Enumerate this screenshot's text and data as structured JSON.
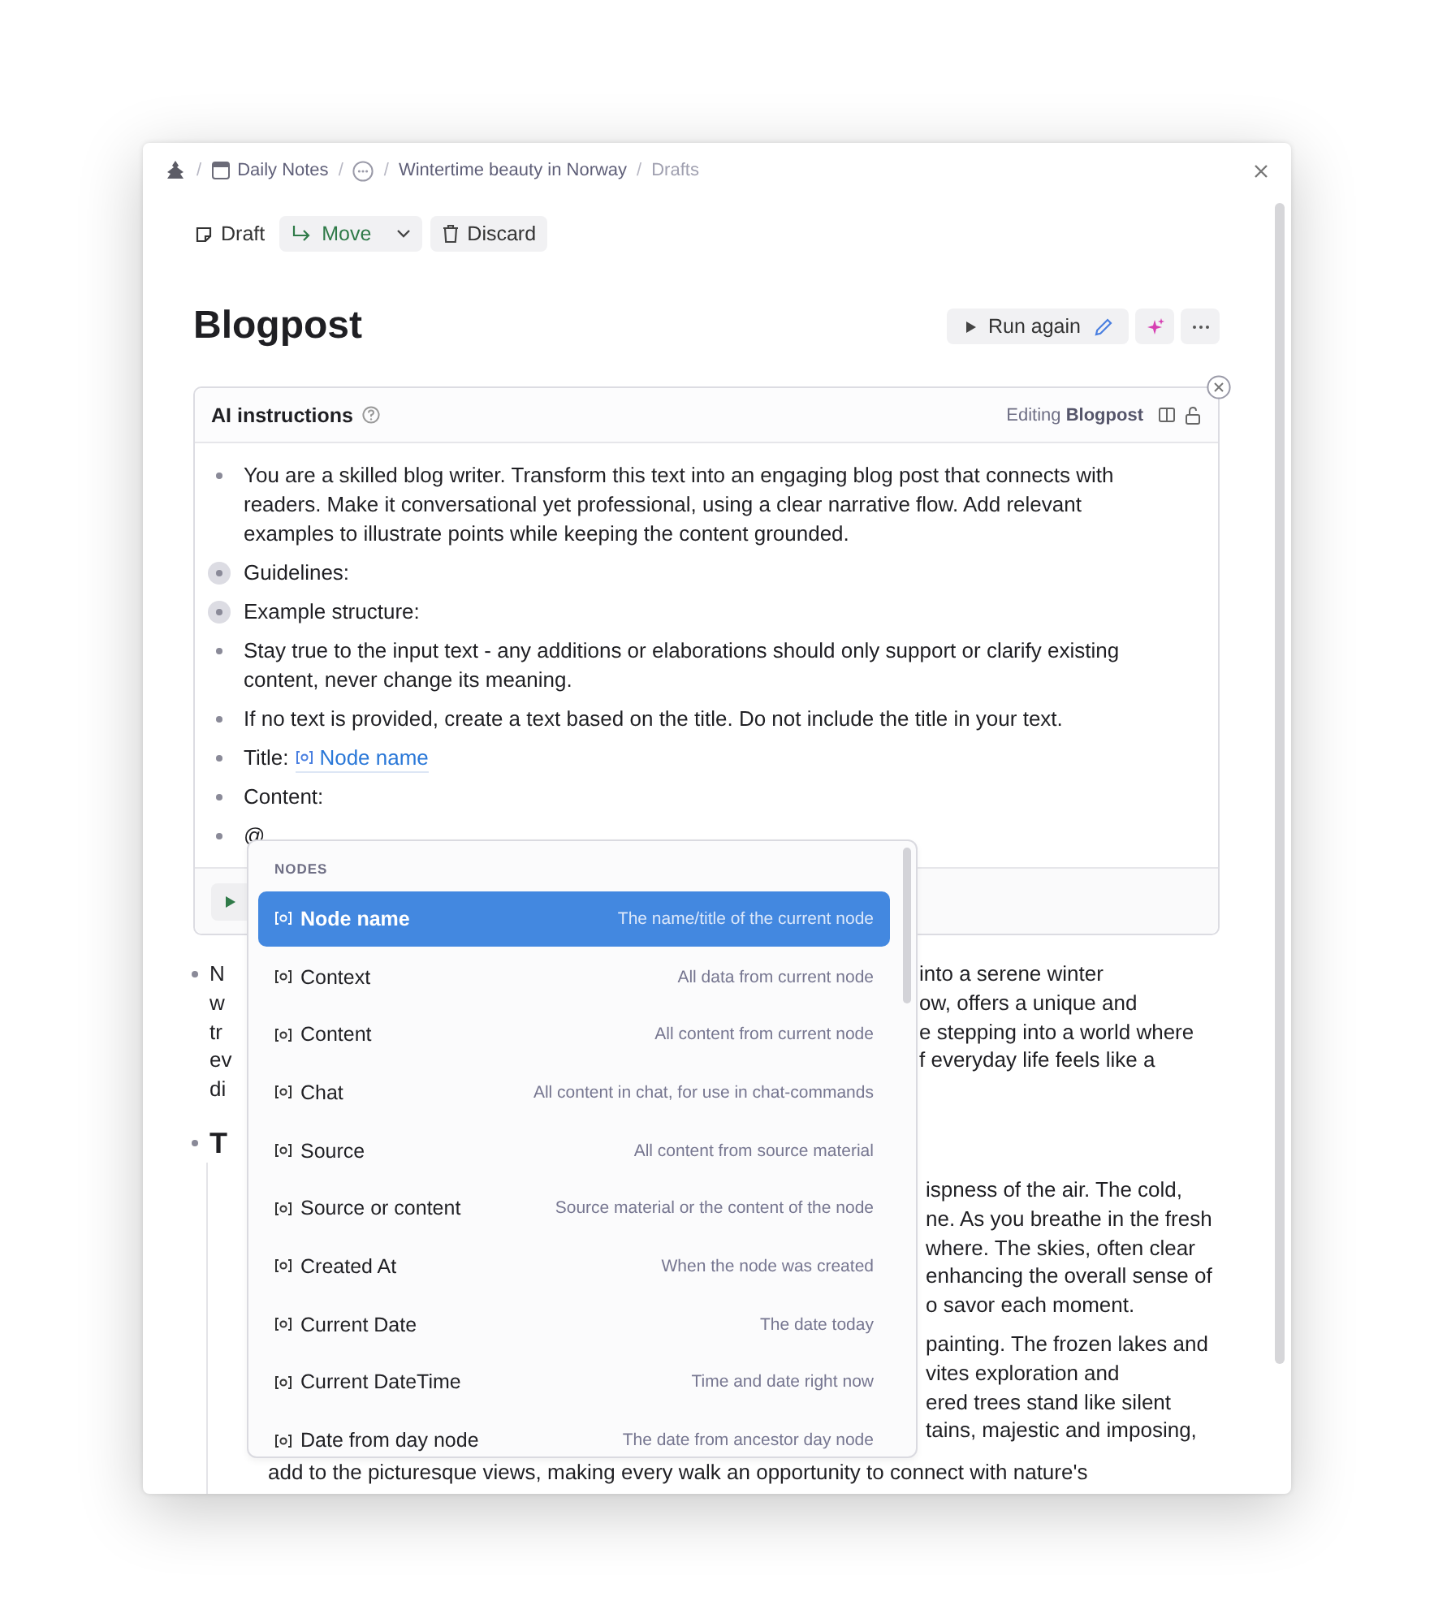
{
  "breadcrumb": [
    {
      "kind": "logo"
    },
    {
      "kind": "calendar_link",
      "label": "Daily Notes",
      "separator": "/"
    },
    {
      "kind": "more",
      "separator": "/"
    },
    {
      "kind": "link",
      "label": "Wintertime beauty in Norway",
      "separator": "/"
    },
    {
      "kind": "current",
      "label": "Drafts",
      "separator": "/"
    }
  ],
  "toolbar": {
    "draft": "Draft",
    "move": "Move",
    "discard": "Discard"
  },
  "title": "Blogpost",
  "actions": {
    "run": "Run again"
  },
  "ai_card": {
    "title": "AI instructions",
    "editing": "Editing **Blogpost**",
    "items": [
      {
        "text": "You are a skilled blog writer. Transform this text into an engaging blog post that connects with readers. Make it conversational yet professional, using a clear narrative flow. Add relevant examples to illustrate points while keeping the content grounded.",
        "collapsed": false
      },
      {
        "text": "Guidelines:",
        "collapsed": true
      },
      {
        "text": "Example structure:",
        "collapsed": true
      },
      {
        "text": "Stay true to the input text - any additions or elaborations should only support or clarify existing content, never change its meaning.",
        "collapsed": false
      },
      {
        "text": "If no text is provided, create a text based on the title. Do not include the title in your text.",
        "collapsed": false
      },
      {
        "text": "Title:",
        "reference": "Node name",
        "collapsed": false
      },
      {
        "text": "Content:",
        "collapsed": false
      },
      {
        "text": "@",
        "collapsed": false
      }
    ]
  },
  "dropdown": {
    "heading": "NODES",
    "items": [
      {
        "name": "Node name",
        "description": "The name/title of the current node",
        "selected": true
      },
      {
        "name": "Context",
        "description": "All data from current node",
        "selected": false
      },
      {
        "name": "Content",
        "description": "All content from current node",
        "selected": false
      },
      {
        "name": "Chat",
        "description": "All content in chat, for use in chat-commands",
        "selected": false
      },
      {
        "name": "Source",
        "description": "All content from source material",
        "selected": false
      },
      {
        "name": "Source or content",
        "description": "Source material or the content of the node",
        "selected": false
      },
      {
        "name": "Created At",
        "description": "When the node was created",
        "selected": false
      },
      {
        "name": "Current Date",
        "description": "The date today",
        "selected": false
      },
      {
        "name": "Current DateTime",
        "description": "Time and date right now",
        "selected": false
      },
      {
        "name": "Date from day node",
        "description": "The date from ancestor day node",
        "selected": false
      }
    ]
  },
  "body": [
    {
      "kind": "bullet",
      "lines": [
        {
          "left": "N",
          "right": "into a serene winter"
        },
        {
          "left": "w",
          "right": "ow, offers a unique and"
        },
        {
          "left": "tr",
          "right": "e stepping into a world where"
        },
        {
          "left": "ev",
          "right": "f everyday life feels like a"
        },
        {
          "left": "di"
        }
      ]
    },
    {
      "kind": "heading",
      "lines": [
        {
          "left": "T"
        }
      ]
    },
    {
      "kind": "paragraph",
      "lines": [
        {
          "right": "ispness of the air. The cold,"
        },
        {
          "right": "ne. As you breathe in the fresh"
        },
        {
          "right": "where. The skies, often clear"
        },
        {
          "right": "enhancing the overall sense of"
        },
        {
          "right": "o savor each moment."
        }
      ]
    },
    {
      "kind": "paragraph",
      "lines": [
        {
          "right": "painting. The frozen lakes and"
        },
        {
          "right": "vites exploration and"
        },
        {
          "right": "ered trees stand like silent"
        },
        {
          "right": "tains, majestic and imposing,"
        },
        {
          "text": "add to the picturesque views, making every walk an opportunity to connect with nature's"
        }
      ]
    }
  ]
}
